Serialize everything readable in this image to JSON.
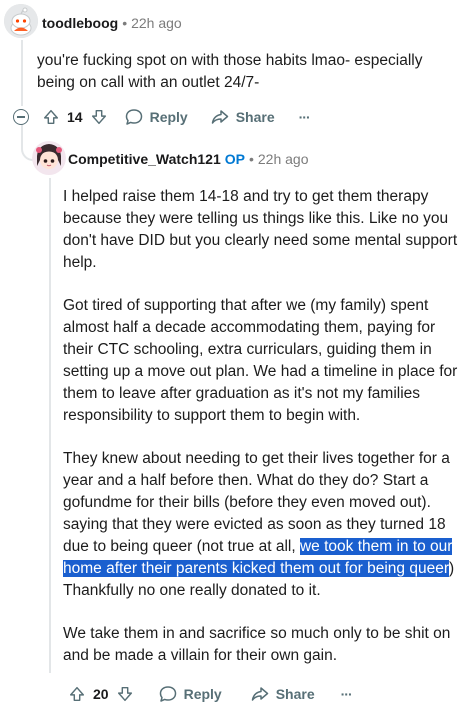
{
  "comment1": {
    "username": "toodleboog",
    "time": "22h ago",
    "text": "you're fucking spot on with those habits lmao- especially being on call with an outlet 24/7-",
    "votes": "14",
    "reply_label": "Reply",
    "share_label": "Share",
    "more_label": "···"
  },
  "comment2": {
    "username": "Competitive_Watch121",
    "op_label": "OP",
    "time": "22h ago",
    "p1": "I helped raise them 14-18 and try to get them therapy because they were telling us things like this. Like no you don't have DID but you clearly need some mental support help.",
    "p2": "Got tired of supporting that after we (my family) spent almost half a decade accommodating them, paying for their CTC schooling, extra curriculars, guiding them in setting up a move out plan. We had a timeline in place for them to leave after graduation as it's not my families responsibility to support them to begin with.",
    "p3_before": "They knew about needing to get their lives together for a year and a half before then. What do they do? Start a gofundme for their bills (before they even moved out). saying that they were evicted as soon as they turned 18 due to being queer (not true at all, ",
    "p3_highlight": "we took them in to our home after their parents kicked them out for being queer",
    "p3_after": ") Thankfully no one really donated to it.",
    "p4": "We take them in and sacrifice so much only to be shit on and be made a villain for their own gain.",
    "votes": "20",
    "reply_label": "Reply",
    "share_label": "Share",
    "more_label": "···"
  }
}
